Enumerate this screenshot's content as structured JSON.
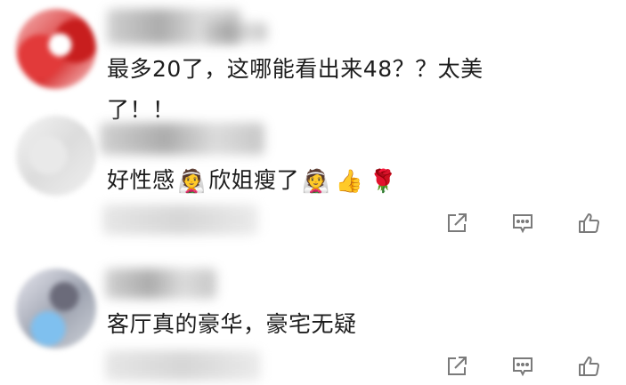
{
  "comments": [
    {
      "text_line1": "最多20了，这哪能看出来48？？太美",
      "text_line2": "了！！",
      "avatar_style": "red"
    },
    {
      "text_prefix": "好性感",
      "text_middle": "欣姐瘦了",
      "emoji_bride": "👰",
      "emoji_thumb": "👍",
      "emoji_rose": "🌹",
      "avatar_style": "grey"
    },
    {
      "text": "客厅真的豪华，豪宅无疑",
      "avatar_style": "blue"
    }
  ],
  "icons": {
    "share": "share-icon",
    "reply": "comment-icon",
    "like": "thumbs-up-icon"
  },
  "colors": {
    "text": "#1d1d1d",
    "icon": "#7a7a7a",
    "background": "#ffffff"
  }
}
